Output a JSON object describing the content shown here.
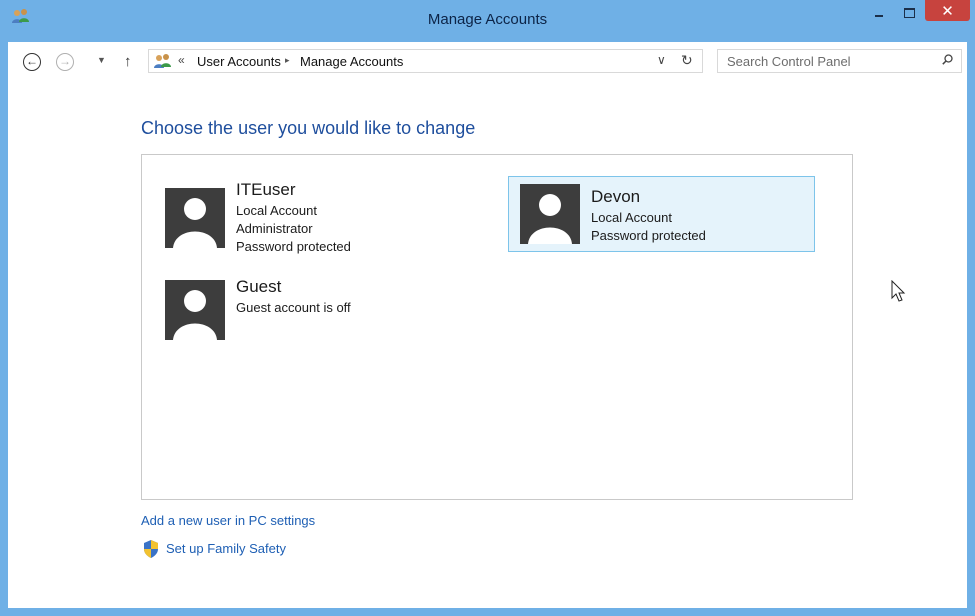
{
  "window": {
    "title": "Manage Accounts",
    "controls": {
      "minimize": "minimize",
      "maximize": "maximize",
      "close_label": "✕"
    }
  },
  "nav": {
    "back_glyph": "←",
    "forward_glyph": "→",
    "recent_glyph": "▼",
    "up_glyph": "↑",
    "breadcrumb_sep": "«",
    "breadcrumb": [
      "User Accounts",
      "Manage Accounts"
    ],
    "crumb_arrow": "▸",
    "dropdown_glyph": "∨",
    "refresh_glyph": "↻"
  },
  "search": {
    "placeholder": "Search Control Panel",
    "value": ""
  },
  "content": {
    "heading": "Choose the user you would like to change",
    "accounts": [
      {
        "name": "ITEuser",
        "lines": [
          "Local Account",
          "Administrator",
          "Password protected"
        ],
        "selected": false
      },
      {
        "name": "Devon",
        "lines": [
          "Local Account",
          "Password protected"
        ],
        "selected": true
      },
      {
        "name": "Guest",
        "lines": [
          "Guest account is off"
        ],
        "selected": false
      }
    ],
    "add_user_link": "Add a new user in PC settings",
    "family_safety_link": "Set up Family Safety"
  },
  "colors": {
    "frame": "#6fb0e6",
    "close_button": "#c7433e",
    "heading": "#1e4e9d",
    "link": "#1e5fb4",
    "selected_bg": "#e5f3fb",
    "selected_border": "#7dc4ea",
    "avatar_bg": "#3d3d3d"
  },
  "icons": {
    "title": "users-icon",
    "address": "users-icon",
    "search": "search-icon",
    "family": "shield-icon",
    "avatar": "user-silhouette-icon",
    "pointer": "mouse-pointer-icon"
  }
}
